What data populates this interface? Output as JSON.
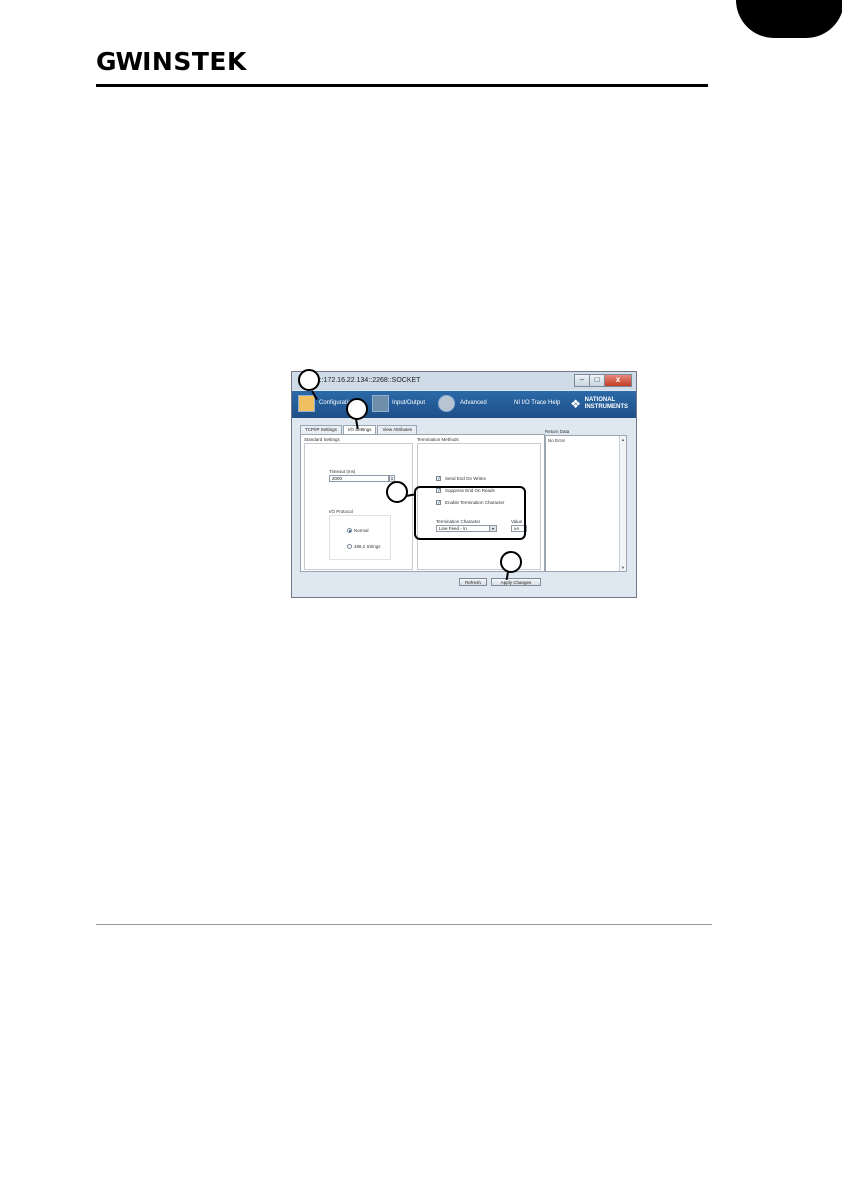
{
  "header": {
    "logo_gw": "GW",
    "logo_rest": "INSTEK"
  },
  "window": {
    "title": "P::172.16.22.134::2268::SOCKET",
    "toolbar": {
      "configuration": "Configuration",
      "input_output": "Input/Output",
      "advanced": "Advanced",
      "nio_trace": "NI I/O Trace",
      "help": "Help",
      "ni_logo_line1": "NATIONAL",
      "ni_logo_line2": "INSTRUMENTS"
    },
    "tabs": [
      "TCP/IP Settings",
      "I/O Settings",
      "View Attributes"
    ],
    "standard_settings": {
      "title": "Standard Settings",
      "timeout_label": "Timeout (ms)",
      "timeout_value": "2000",
      "io_protocol_label": "I/O Protocol",
      "protocol_normal": "Normal",
      "protocol_4882": "488.2 Strings"
    },
    "termination": {
      "title": "Termination Methods",
      "send_end": "Send End On Writes",
      "suppress_end": "Suppress End On Reads",
      "enable_term": "Enable Termination Character",
      "term_char_label": "Termination Character",
      "term_char_value": "Line Feed - \\n",
      "value_label": "Value",
      "value_value": "xA"
    },
    "return_data": {
      "label": "Return Data",
      "value": "No Error"
    },
    "buttons": {
      "refresh": "Refresh",
      "apply": "Apply Changes"
    }
  },
  "colors": {
    "toolbar": "#1d4f87",
    "highlight": "#000000"
  }
}
